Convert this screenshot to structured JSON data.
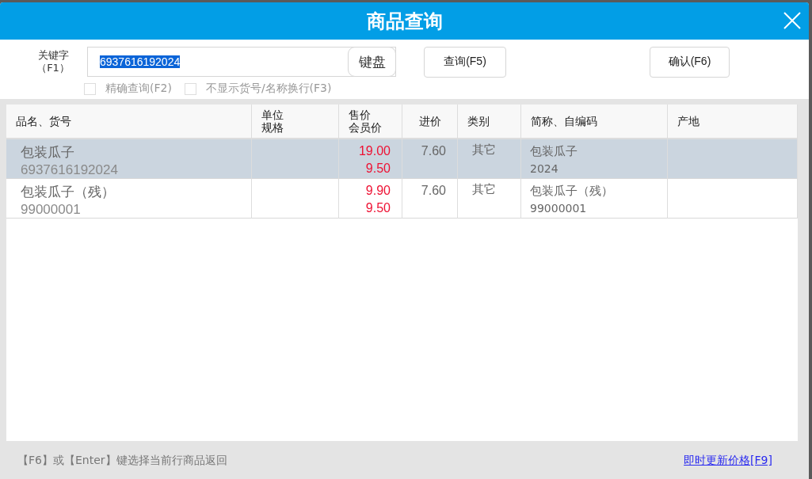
{
  "window": {
    "title": "商品查询"
  },
  "search": {
    "label_lines": [
      "关键字",
      "（F1）"
    ],
    "value": "6937616192024",
    "value_selected": true,
    "keyboard_button": "键盘"
  },
  "buttons": [
    {
      "kind": "query",
      "label": "查询(F5)"
    },
    {
      "kind": "confirm",
      "label": "确认(F6)"
    }
  ],
  "options": [
    {
      "label": "精确查询(F2)",
      "checked": false
    },
    {
      "label": "不显示货号/名称换行(F3)",
      "checked": false
    }
  ],
  "table": {
    "columns": [
      {
        "lines": [
          "品名、货号"
        ]
      },
      {
        "lines": [
          "单位",
          "规格"
        ]
      },
      {
        "lines": [
          "售价",
          "会员价"
        ]
      },
      {
        "lines": [
          "进价"
        ]
      },
      {
        "lines": [
          "类别"
        ]
      },
      {
        "lines": [
          "简称、自编码"
        ]
      },
      {
        "lines": [
          "产地"
        ]
      }
    ],
    "rows": [
      {
        "selected": true,
        "name": "包装瓜子",
        "code": "6937616192024",
        "price": "19.00",
        "member_price": "9.50",
        "cost": "7.60",
        "category": "其它",
        "short_name": "包装瓜子",
        "self_code": "2024"
      },
      {
        "selected": false,
        "name": "包装瓜子（残）",
        "code": "99000001",
        "price": "9.90",
        "member_price": "9.50",
        "cost": "7.60",
        "category": "其它",
        "short_name": "包装瓜子（残）",
        "self_code": "99000001"
      }
    ]
  },
  "footer": {
    "hint": "【F6】或【Enter】键选择当前行商品返回",
    "link": "即时更新价格[F9]"
  }
}
